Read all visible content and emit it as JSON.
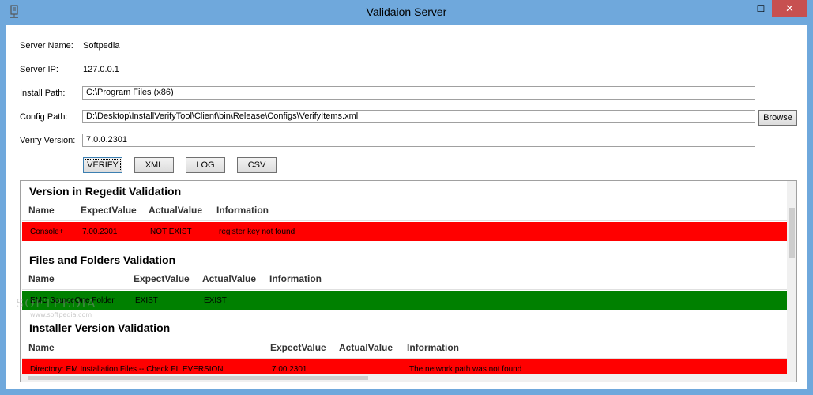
{
  "window": {
    "title": "Validaion Server",
    "icon": "server-icon",
    "controls": {
      "minimize": "–",
      "maximize": "☐",
      "close": "✕"
    }
  },
  "form": {
    "server_name_label": "Server Name:",
    "server_name_value": "Softpedia",
    "server_ip_label": "Server IP:",
    "server_ip_value": "127.0.0.1",
    "install_path_label": "Install Path:",
    "install_path_value": "C:\\Program Files (x86)",
    "config_path_label": "Config Path:",
    "config_path_value": "D:\\Desktop\\InstallVerifyTool\\Client\\bin\\Release\\Configs\\VerifyItems.xml",
    "browse_label": "Browse",
    "verify_version_label": "Verify Version:",
    "verify_version_value": "7.0.0.2301"
  },
  "actions": {
    "verify": "VERIFY",
    "xml": "XML",
    "log": "LOG",
    "csv": "CSV"
  },
  "sections": [
    {
      "title": "Version in Regedit Validation",
      "columns": [
        "Name",
        "ExpectValue",
        "ActualValue",
        "Information"
      ],
      "rows": [
        {
          "status": "red",
          "cells": [
            "Console+",
            "7.00.2301",
            "NOT EXIST",
            "register key not found"
          ]
        }
      ]
    },
    {
      "title": "Files and Folders Validation",
      "columns": [
        "Name",
        "ExpectValue",
        "ActualValue",
        "Information"
      ],
      "rows": [
        {
          "status": "green",
          "cells": [
            "EMC SourceOne Folder",
            "EXIST",
            "EXIST",
            ""
          ]
        }
      ]
    },
    {
      "title": "Installer Version Validation",
      "columns": [
        "Name",
        "ExpectValue",
        "ActualValue",
        "Information"
      ],
      "rows": [
        {
          "status": "red",
          "cells": [
            "Directory: EM Installation Files -- Check FILEVERSION",
            "7.00.2301",
            "",
            "The network path was not found"
          ]
        }
      ]
    }
  ],
  "watermark": {
    "text": "SOFTPEDIA",
    "subtext": "www.softpedia.com"
  },
  "colors": {
    "fail": "#ff0000",
    "pass": "#008000",
    "titlebar": "#6fa8dc",
    "close": "#c75050"
  }
}
